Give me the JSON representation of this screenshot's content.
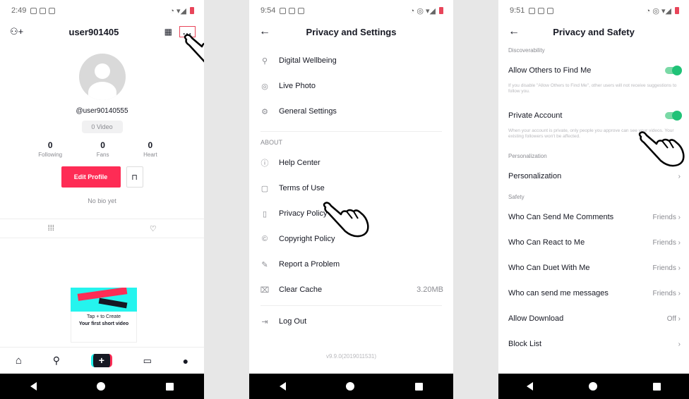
{
  "profile": {
    "status_time": "2:49",
    "username": "user901405",
    "handle": "@user90140555",
    "video_count": "0 Video",
    "stats": [
      {
        "num": "0",
        "label": "Following"
      },
      {
        "num": "0",
        "label": "Fans"
      },
      {
        "num": "0",
        "label": "Heart"
      }
    ],
    "edit_label": "Edit Profile",
    "bio": "No bio yet",
    "promo_line1": "Tap + to Create",
    "promo_line2": "Your first short video",
    "more_label": "...",
    "plus_label": "+"
  },
  "settings": {
    "status_time": "9:54",
    "title": "Privacy and Settings",
    "items_top": [
      {
        "label": "Digital Wellbeing",
        "icon": "wellbeing-icon"
      },
      {
        "label": "Live Photo",
        "icon": "live-photo-icon"
      },
      {
        "label": "General Settings",
        "icon": "gear-icon"
      }
    ],
    "about_label": "ABOUT",
    "items_about": [
      {
        "label": "Help Center",
        "icon": "question-icon"
      },
      {
        "label": "Terms of Use",
        "icon": "document-icon"
      },
      {
        "label": "Privacy Policy",
        "icon": "privacy-icon"
      },
      {
        "label": "Copyright Policy",
        "icon": "copyright-icon"
      },
      {
        "label": "Report a Problem",
        "icon": "pencil-icon"
      },
      {
        "label": "Clear Cache",
        "icon": "trash-icon",
        "value": "3.20MB"
      }
    ],
    "logout_label": "Log Out",
    "version": "v9.9.0(2019011531)"
  },
  "privacy": {
    "status_time": "9:51",
    "title": "Privacy and Safety",
    "discoverability_label": "Discoverability",
    "allow_find_label": "Allow Others to Find Me",
    "allow_find_note": "If you disable \"Allow Others to Find Me\", other users will not receive suggestions to follow you.",
    "private_label": "Private Account",
    "private_note": "When your account is private, only people you approve can see your videos. Your existing followers won't be affected.",
    "personalization_section": "Personalization",
    "personalization_label": "Personalization",
    "safety_label": "Safety",
    "safety_items": [
      {
        "label": "Who Can Send Me Comments",
        "value": "Friends"
      },
      {
        "label": "Who Can React to Me",
        "value": "Friends"
      },
      {
        "label": "Who Can Duet With Me",
        "value": "Friends"
      },
      {
        "label": "Who can send me messages",
        "value": "Friends"
      },
      {
        "label": "Allow Download",
        "value": "Off"
      },
      {
        "label": "Block List",
        "value": ""
      }
    ]
  }
}
